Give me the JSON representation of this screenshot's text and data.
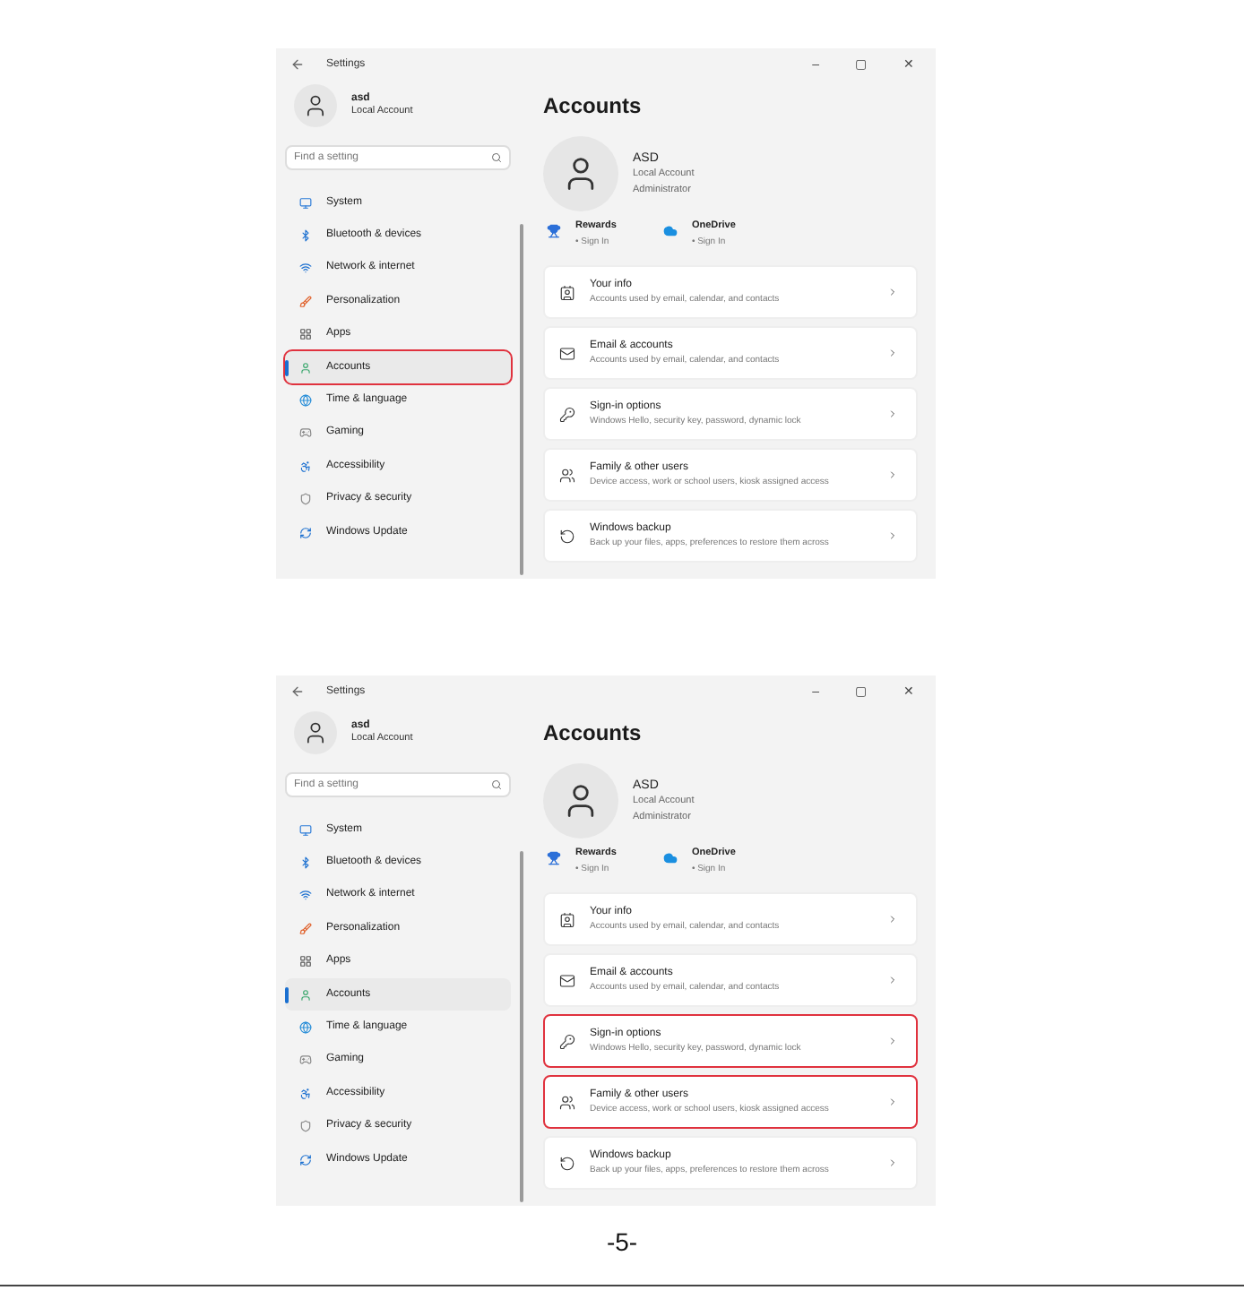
{
  "screenshots": [
    {
      "window": {
        "title": "Settings",
        "controls": [
          "–",
          "▢",
          "✕"
        ]
      },
      "user": {
        "name": "asd",
        "account": "Local Account"
      },
      "search": {
        "placeholder": "Find a setting"
      },
      "nav": [
        {
          "label": "System",
          "selected": false,
          "highlighted": false
        },
        {
          "label": "Bluetooth & devices",
          "selected": false,
          "highlighted": false
        },
        {
          "label": "Network & internet",
          "selected": false,
          "highlighted": false
        },
        {
          "label": "Personalization",
          "selected": false,
          "highlighted": false
        },
        {
          "label": "Apps",
          "selected": false,
          "highlighted": false
        },
        {
          "label": "Accounts",
          "selected": true,
          "highlighted": true
        },
        {
          "label": "Time & language",
          "selected": false,
          "highlighted": false
        },
        {
          "label": "Gaming",
          "selected": false,
          "highlighted": false
        },
        {
          "label": "Accessibility",
          "selected": false,
          "highlighted": false
        },
        {
          "label": "Privacy & security",
          "selected": false,
          "highlighted": false
        },
        {
          "label": "Windows Update",
          "selected": false,
          "highlighted": false
        }
      ],
      "page_title": "Accounts",
      "profile": {
        "name": "ASD",
        "lines": [
          "Local Account",
          "Administrator"
        ]
      },
      "services": [
        {
          "name": "Rewards",
          "status": "• Sign In"
        },
        {
          "name": "OneDrive",
          "status": "• Sign In"
        }
      ],
      "settings": [
        {
          "title": "Your info",
          "description": "Accounts used by email, calendar, and contacts",
          "highlighted": false
        },
        {
          "title": "Email & accounts",
          "description": "Accounts used by email, calendar, and contacts",
          "highlighted": false
        },
        {
          "title": "Sign-in options",
          "description": "Windows Hello, security key, password, dynamic lock",
          "highlighted": false
        },
        {
          "title": "Family & other users",
          "description": "Device access, work or school users, kiosk assigned access",
          "highlighted": false
        },
        {
          "title": "Windows backup",
          "description": "Back up your files, apps, preferences to restore them across",
          "highlighted": false
        }
      ]
    },
    {
      "window": {
        "title": "Settings",
        "controls": [
          "–",
          "▢",
          "✕"
        ]
      },
      "user": {
        "name": "asd",
        "account": "Local Account"
      },
      "search": {
        "placeholder": "Find a setting"
      },
      "nav": [
        {
          "label": "System",
          "selected": false,
          "highlighted": false
        },
        {
          "label": "Bluetooth & devices",
          "selected": false,
          "highlighted": false
        },
        {
          "label": "Network & internet",
          "selected": false,
          "highlighted": false
        },
        {
          "label": "Personalization",
          "selected": false,
          "highlighted": false
        },
        {
          "label": "Apps",
          "selected": false,
          "highlighted": false
        },
        {
          "label": "Accounts",
          "selected": true,
          "highlighted": false
        },
        {
          "label": "Time & language",
          "selected": false,
          "highlighted": false
        },
        {
          "label": "Gaming",
          "selected": false,
          "highlighted": false
        },
        {
          "label": "Accessibility",
          "selected": false,
          "highlighted": false
        },
        {
          "label": "Privacy & security",
          "selected": false,
          "highlighted": false
        },
        {
          "label": "Windows Update",
          "selected": false,
          "highlighted": false
        }
      ],
      "page_title": "Accounts",
      "profile": {
        "name": "ASD",
        "lines": [
          "Local Account",
          "Administrator"
        ]
      },
      "services": [
        {
          "name": "Rewards",
          "status": "• Sign In"
        },
        {
          "name": "OneDrive",
          "status": "• Sign In"
        }
      ],
      "settings": [
        {
          "title": "Your info",
          "description": "Accounts used by email, calendar, and contacts",
          "highlighted": false
        },
        {
          "title": "Email & accounts",
          "description": "Accounts used by email, calendar, and contacts",
          "highlighted": false
        },
        {
          "title": "Sign-in options",
          "description": "Windows Hello, security key, password, dynamic lock",
          "highlighted": true
        },
        {
          "title": "Family & other users",
          "description": "Device access, work or school users, kiosk assigned access",
          "highlighted": true
        },
        {
          "title": "Windows backup",
          "description": "Back up your files, apps, preferences to restore them across",
          "highlighted": false
        }
      ]
    }
  ],
  "page_number": "-5-"
}
